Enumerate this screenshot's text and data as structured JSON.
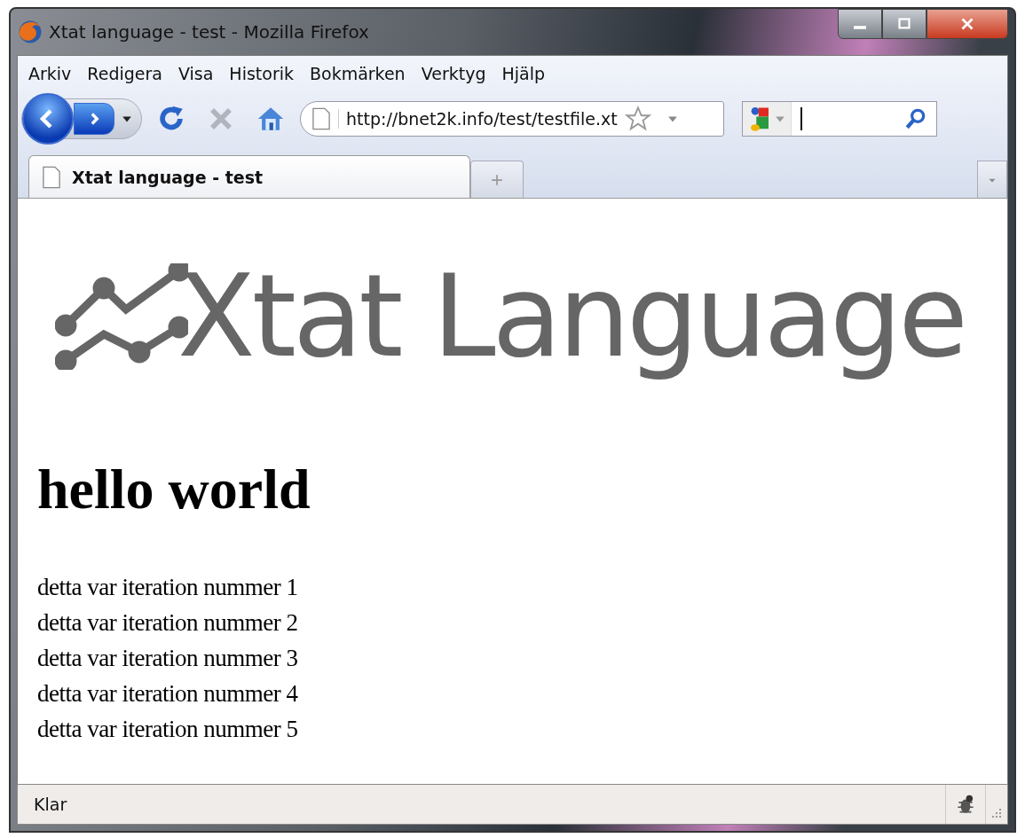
{
  "window": {
    "title": "Xtat language - test - Mozilla Firefox"
  },
  "menu": [
    "Arkiv",
    "Redigera",
    "Visa",
    "Historik",
    "Bokmärken",
    "Verktyg",
    "Hjälp"
  ],
  "address": {
    "value": "http://bnet2k.info/test/testfile.xt"
  },
  "tabs": [
    {
      "label": "Xtat language - test",
      "selected": true
    }
  ],
  "page": {
    "logo": "Xtat Language",
    "heading": "hello world",
    "lines": [
      "detta var iteration nummer 1",
      "detta var iteration nummer 2",
      "detta var iteration nummer 3",
      "detta var iteration nummer 4",
      "detta var iteration nummer 5"
    ]
  },
  "status_bar": {
    "text": "Klar"
  }
}
